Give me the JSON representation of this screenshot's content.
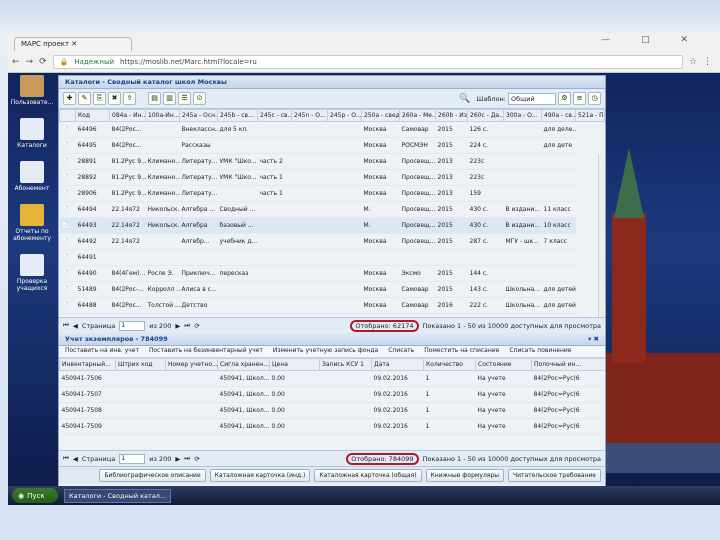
{
  "browser": {
    "tab_title": "МАРС проект",
    "secure_label": "Надежный",
    "url": "https://moslib.net/Marc.html?locale=ru",
    "window_buttons": "— □ ✕"
  },
  "desktop": {
    "icons": [
      {
        "label": "Пользовате...",
        "name": "users"
      },
      {
        "label": "Каталоги",
        "name": "catalogs"
      },
      {
        "label": "Абонемент",
        "name": "loan"
      },
      {
        "label": "Отчеты по абонементу",
        "name": "reports"
      },
      {
        "label": "Проверка учащихся",
        "name": "check"
      }
    ]
  },
  "catalog_panel": {
    "title": "Каталоги - Сводный каталог школ Москвы",
    "template_label": "Шаблон:",
    "template_value": "Общий",
    "columns": [
      "",
      "Код",
      "084a - Ин...",
      "100a-Ин...",
      "245a - Осн...",
      "245b - св...",
      "245c - св...",
      "245n - О...",
      "245p - О...",
      "250a - свед...",
      "260a - Ме...",
      "260b - Из...",
      "260c - Да...",
      "300a - О...",
      "490a - св...",
      "521a - П..."
    ],
    "rows": [
      [
        "",
        "64496",
        "84(2Рос...",
        "",
        "Внеклассн...",
        "для 5 кл.",
        "",
        "",
        "",
        "Москва",
        "Самовар",
        "2015",
        "126 с.",
        "",
        "для деле..."
      ],
      [
        "",
        "64495",
        "84(2Рос...",
        "",
        "Рассказы",
        "",
        "",
        "",
        "",
        "Москва",
        "РОСМЭН",
        "2015",
        "224 с.",
        "",
        "для дете"
      ],
      [
        "",
        "28891",
        "81.2Рус 9...",
        "Климано...",
        "Литерату...",
        "УМК \"Шко...",
        "часть 2",
        "",
        "",
        "Москва",
        "Просвещ...",
        "2013",
        "223с",
        "",
        ""
      ],
      [
        "",
        "28892",
        "81.2Рус 9...",
        "Климано...",
        "Литерату...",
        "УМК \"Шко...",
        "часть 1",
        "",
        "",
        "Москва",
        "Просвещ...",
        "2013",
        "223с",
        "",
        ""
      ],
      [
        "",
        "28906",
        "81.2Рус 9...",
        "Климано...",
        "Литерату...",
        "",
        "часть 1",
        "",
        "",
        "Москва",
        "Просвещ...",
        "2013",
        "159",
        "",
        ""
      ],
      [
        "",
        "64494",
        "22.14я72",
        "Никольск...",
        "Алгебра ...",
        "Сводный ...",
        "",
        "",
        "",
        "М.",
        "Просвещ...",
        "2015",
        "430 с.",
        "В издани...",
        "11 класс"
      ],
      [
        "",
        "64493",
        "22.14я72",
        "Никольск...",
        "Алгебра",
        "базовый ...",
        "",
        "",
        "",
        "М.",
        "Просвещ...",
        "2015",
        "430 с.",
        "В издани...",
        "10 класс"
      ],
      [
        "",
        "64492",
        "22.14я72",
        "",
        "Алгебр...",
        "учебник д...",
        "",
        "",
        "",
        "Москва",
        "Просвещ...",
        "2015",
        "287 с.",
        "МГУ - шк...",
        "7 класс"
      ],
      [
        "",
        "64491",
        "",
        "",
        "",
        "",
        "",
        "",
        "",
        "",
        "",
        "",
        "",
        "",
        ""
      ],
      [
        "",
        "64490",
        "84(4Гем)...",
        "Росле Э.",
        "Приключ...",
        "пересказ",
        "",
        "",
        "",
        "Москва",
        "Эксмо",
        "2015",
        "144 с.",
        "",
        ""
      ],
      [
        "",
        "51489",
        "84(2Рос-...",
        "Корролл ...",
        "Алиса в с...",
        "",
        "",
        "",
        "",
        "Москва",
        "Самовар",
        "2015",
        "143 с.",
        "Школьна...",
        "для детей..."
      ],
      [
        "",
        "64488",
        "84(2Рос...",
        "Толстой ...",
        "Детство",
        "",
        "",
        "",
        "",
        "Москва",
        "Самовар",
        "2016",
        "222 с.",
        "Школьна...",
        "для детей..."
      ]
    ],
    "selected_row": 6,
    "pager": {
      "page_label": "Страница",
      "page_value": "1",
      "of_label": "из 200",
      "shown": "Отобрано: 62174",
      "summary": "Показано 1 - 50 из 10000 доступных для просмотра"
    }
  },
  "copies_panel": {
    "title": "Учет экземпляров - 784099",
    "operations": [
      "Поставить на инв. учет",
      "Поставить на безинвентарный учет",
      "Изменить учетную запись фонда",
      "Списать",
      "Поместить на списание",
      "Списать повинение"
    ],
    "columns": [
      "Инвентарный...",
      "Штрих код",
      "Номер учетно...",
      "Сигла хранен...",
      "Цена",
      "Запись КСУ 1",
      "Дата",
      "Количество",
      "Состояние",
      "Полочный ин..."
    ],
    "rows": [
      [
        "450941-7506",
        "",
        "",
        "450941, Школ...",
        "0.00",
        "",
        "09.02.2016",
        "1",
        "На учете",
        "84(2Рос=Рус)6"
      ],
      [
        "450941-7507",
        "",
        "",
        "450941, Школ...",
        "0.00",
        "",
        "09.02.2016",
        "1",
        "На учете",
        "84(2Рос=Рус)6"
      ],
      [
        "450941-7508",
        "",
        "",
        "450941, Школ...",
        "0.00",
        "",
        "09.02.2016",
        "1",
        "На учете",
        "84(2Рос=Рус)6"
      ],
      [
        "450941-7509",
        "",
        "",
        "450941, Школ...",
        "0.00",
        "",
        "09.02.2016",
        "1",
        "На учете",
        "84(2Рос=Рус)6"
      ]
    ],
    "pager": {
      "page_label": "Страница",
      "page_value": "1",
      "of_label": "из 200",
      "shown": "Отобрано: 784099",
      "summary": "Показано 1 - 50 из 10000 доступных для просмотра"
    }
  },
  "bottom_buttons": [
    "Библиографическое описание",
    "Каталожная карточка (инд.)",
    "Каталожная карточка (общая)",
    "Книжные формуляры",
    "Читательское требование"
  ],
  "taskbar": {
    "start_label": "Пуск",
    "task_label": "Каталоги - Сводный катал..."
  },
  "colors": {
    "highlight_circle": "#b2192a",
    "panel_title": "#15428b"
  }
}
